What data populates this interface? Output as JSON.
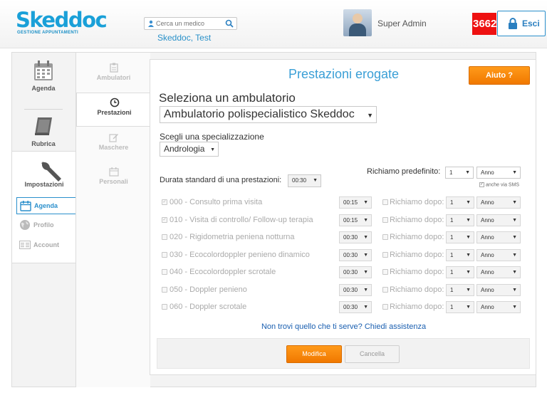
{
  "header": {
    "logo_text": "Skeddoc",
    "logo_subtitle": "GESTIONE APPUNTAMENTI",
    "search_placeholder": "Cerca un medico",
    "doctor_name": "Skeddoc, Test",
    "user_name": "Super Admin",
    "notification_count": "3662",
    "logout_label": "Esci"
  },
  "left_nav": {
    "agenda": "Agenda",
    "rubrica": "Rubrica",
    "impostazioni": "Impostazioni",
    "sub": [
      {
        "label": "Agenda",
        "icon": "calendar-icon",
        "active": true
      },
      {
        "label": "Profilo",
        "icon": "globe-icon",
        "active": false
      },
      {
        "label": "Account",
        "icon": "card-icon",
        "active": false
      }
    ]
  },
  "mid_nav": [
    {
      "label": "Ambulatori",
      "icon": "clipboard-icon",
      "active": false
    },
    {
      "label": "Prestazioni",
      "icon": "clock-icon",
      "active": true
    },
    {
      "label": "Maschere",
      "icon": "edit-icon",
      "active": false
    },
    {
      "label": "Personali",
      "icon": "calendar-icon",
      "active": false
    }
  ],
  "content": {
    "title": "Prestazioni erogate",
    "help_label": "Aiuto ?",
    "ambulatorio_heading": "Seleziona un ambulatorio",
    "ambulatorio_value": "Ambulatorio polispecialistico Skeddoc",
    "specializzazione_heading": "Scegli una specializzazione",
    "specializzazione_value": "Andrologia",
    "durata_label": "Durata standard di una prestazioni:",
    "durata_value": "00:30",
    "richiamo_label": "Richiamo predefinito:",
    "richiamo_num": "1",
    "richiamo_unit": "Anno",
    "sms_label": "anche via SMS",
    "richiamo_dopo_label": "Richiamo dopo:",
    "prestazioni": [
      {
        "name": "000 - Consulto prima visita",
        "checked": true,
        "duration": "00:15",
        "num": "1",
        "unit": "Anno"
      },
      {
        "name": "010 - Visita di controllo/ Follow-up terapia",
        "checked": true,
        "duration": "00:15",
        "num": "1",
        "unit": "Anno"
      },
      {
        "name": "020 - Rigidometria peniena notturna",
        "checked": false,
        "duration": "00:30",
        "num": "1",
        "unit": "Anno"
      },
      {
        "name": "030 - Ecocolordoppler penieno dinamico",
        "checked": false,
        "duration": "00:30",
        "num": "1",
        "unit": "Anno"
      },
      {
        "name": "040 - Ecocolordoppler scrotale",
        "checked": false,
        "duration": "00:30",
        "num": "1",
        "unit": "Anno"
      },
      {
        "name": "050 - Doppler penieno",
        "checked": false,
        "duration": "00:30",
        "num": "1",
        "unit": "Anno"
      },
      {
        "name": "060 - Doppler scrotale",
        "checked": false,
        "duration": "00:30",
        "num": "1",
        "unit": "Anno"
      }
    ],
    "assist_link": "Non trovi quello che ti serve? Chiedi assistenza",
    "save_label": "Modifica",
    "cancel_label": "Cancella"
  }
}
